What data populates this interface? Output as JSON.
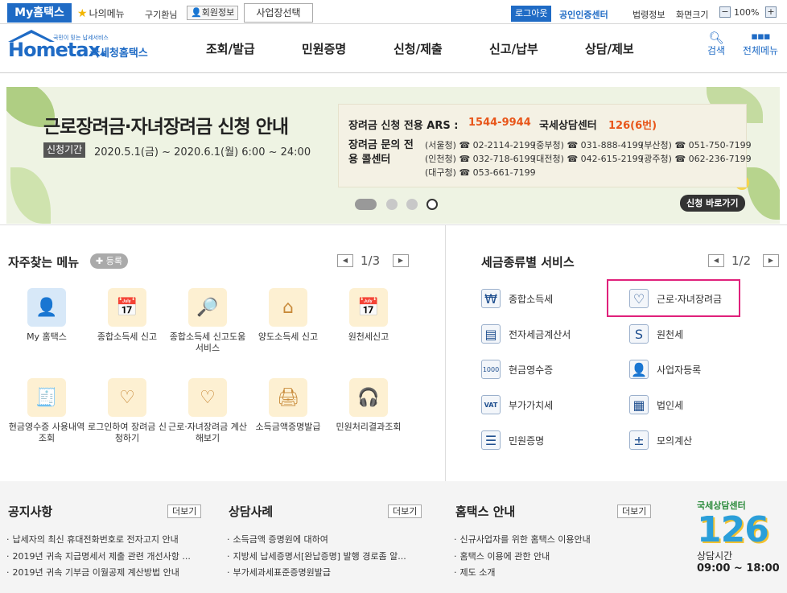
{
  "topbar": {
    "my_hometax": "My홈택스",
    "my_menu": "나의메뉴",
    "greeting": "구기환님",
    "member_info": "회원정보",
    "business_select": "사업장선택",
    "logout": "로그아웃",
    "cert_center": "공인인증센터",
    "law_info": "법령정보",
    "screen_size": "화면크기",
    "zoom_minus": "−",
    "zoom_value": "100%",
    "zoom_plus": "+"
  },
  "logo": {
    "tagline": "국민이 믿는 납세서비스",
    "brand": "Hometax.",
    "brand_kr": "국세청홈택스"
  },
  "gnb": {
    "items": [
      "조회/발급",
      "민원증명",
      "신청/제출",
      "신고/납부",
      "상담/제보"
    ],
    "search": "검색",
    "all_menu": "전체메뉴"
  },
  "banner": {
    "title": "근로장려금·자녀장려금 신청 안내",
    "period_badge": "신청기간",
    "period": "2020.5.1(금) ~ 2020.6.1(월) 6:00 ~ 24:00",
    "ars_label": "장려금 신청 전용 ARS :",
    "ars_number": "1544-9944",
    "center_label": "국세상담센터",
    "center_number": "126(6번)",
    "inquiry_label": "장려금 문의 전용 콜센터",
    "call_centers": [
      "(서울청) ☎ 02-2114-2199",
      "(중부청) ☎ 031-888-4199",
      "(부산청) ☎ 051-750-7199",
      "(인천청) ☎ 032-718-6199",
      "(대전청) ☎ 042-615-2199",
      "(광주청) ☎ 062-236-7199",
      "(대구청) ☎ 053-661-7199"
    ],
    "apply_button": "신청 바로가기"
  },
  "favorites": {
    "title": "자주찾는 메뉴",
    "register": "등록",
    "page": "1/3",
    "items": [
      {
        "label": "My 홈택스",
        "icon": "person-icon"
      },
      {
        "label": "종합소득세 신고",
        "icon": "calendar-pen-icon"
      },
      {
        "label": "종합소득세 신고도움 서비스",
        "icon": "document-search-icon"
      },
      {
        "label": "양도소득세 신고",
        "icon": "house-pen-icon"
      },
      {
        "label": "원천세신고",
        "icon": "calendar-pen-icon"
      },
      {
        "label": "현금영수증 사용내역조회",
        "icon": "receipt-search-icon"
      },
      {
        "label": "로그인하여 장려금 신청하기",
        "icon": "heart-pen-icon"
      },
      {
        "label": "근로·자녀장려금 계산해보기",
        "icon": "heart-document-icon"
      },
      {
        "label": "소득금액증명발급",
        "icon": "printer-icon"
      },
      {
        "label": "민원처리결과조회",
        "icon": "headset-icon"
      }
    ]
  },
  "tax_services": {
    "title": "세금종류별 서비스",
    "page": "1/2",
    "items": [
      {
        "label": "종합소득세",
        "icon": "money-bag-icon"
      },
      {
        "label": "근로·자녀장려금",
        "icon": "heart-hands-icon"
      },
      {
        "label": "전자세금계산서",
        "icon": "invoice-icon"
      },
      {
        "label": "원천세",
        "icon": "sal-document-icon"
      },
      {
        "label": "현금영수증",
        "icon": "cash-receipt-icon"
      },
      {
        "label": "사업자등록",
        "icon": "person-outline-icon"
      },
      {
        "label": "부가가치세",
        "icon": "vat-icon"
      },
      {
        "label": "법인세",
        "icon": "building-icon"
      },
      {
        "label": "민원증명",
        "icon": "document-icon"
      },
      {
        "label": "모의계산",
        "icon": "calculator-icon"
      }
    ]
  },
  "notices": {
    "title": "공지사항",
    "more": "더보기",
    "items": [
      "납세자의 최신 휴대전화번호로 전자고지 안내",
      "2019년 귀속 지급명세서 제출 관련 개선사항 ...",
      "2019년 귀속 기부금 이월공제 계산방법 안내"
    ]
  },
  "cases": {
    "title": "상담사례",
    "more": "더보기",
    "items": [
      "소득금액 증명원에 대하여",
      "지방세 납세증명서[완납증명] 발행 경로좀 알...",
      "부가세과세표준증명원발급"
    ]
  },
  "guide": {
    "title": "홈택스 안내",
    "more": "더보기",
    "items": [
      "신규사업자를 위한 홈택스 이용안내",
      "홈택스 이용에 관한 안내",
      "제도 소개"
    ]
  },
  "call_center": {
    "title": "국세상담센터",
    "number": "126",
    "hours_label": "상담시간",
    "hours": "09:00 ~ 18:00"
  },
  "colors": {
    "primary": "#1f6bc5",
    "accent_orange": "#e8561a",
    "highlight": "#e0217b"
  }
}
